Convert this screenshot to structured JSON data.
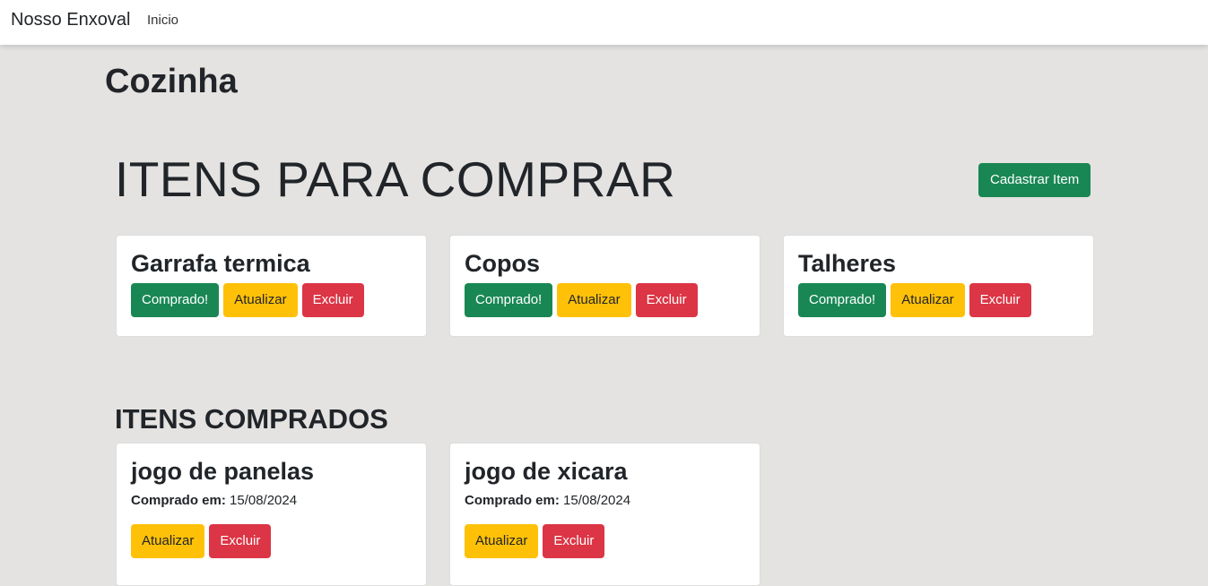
{
  "navbar": {
    "brand": "Nosso Enxoval",
    "link": "Inicio"
  },
  "category": "Cozinha",
  "to_buy": {
    "title": "ITENS PARA COMPRAR",
    "add_label": "Cadastrar Item",
    "items": [
      {
        "name": "Garrafa termica"
      },
      {
        "name": "Copos"
      },
      {
        "name": "Talheres"
      }
    ],
    "buy_label": "Comprado!",
    "update_label": "Atualizar",
    "delete_label": "Excluir"
  },
  "bought": {
    "title": "ITENS COMPRADOS",
    "date_label": "Comprado em:",
    "update_label": "Atualizar",
    "delete_label": "Excluir",
    "items": [
      {
        "name": "jogo de panelas",
        "date": "15/08/2024"
      },
      {
        "name": "jogo de xicara",
        "date": "15/08/2024"
      }
    ]
  },
  "colors": {
    "success": "#198754",
    "warning": "#ffc107",
    "danger": "#dc3545",
    "background": "#e4e3e1"
  }
}
